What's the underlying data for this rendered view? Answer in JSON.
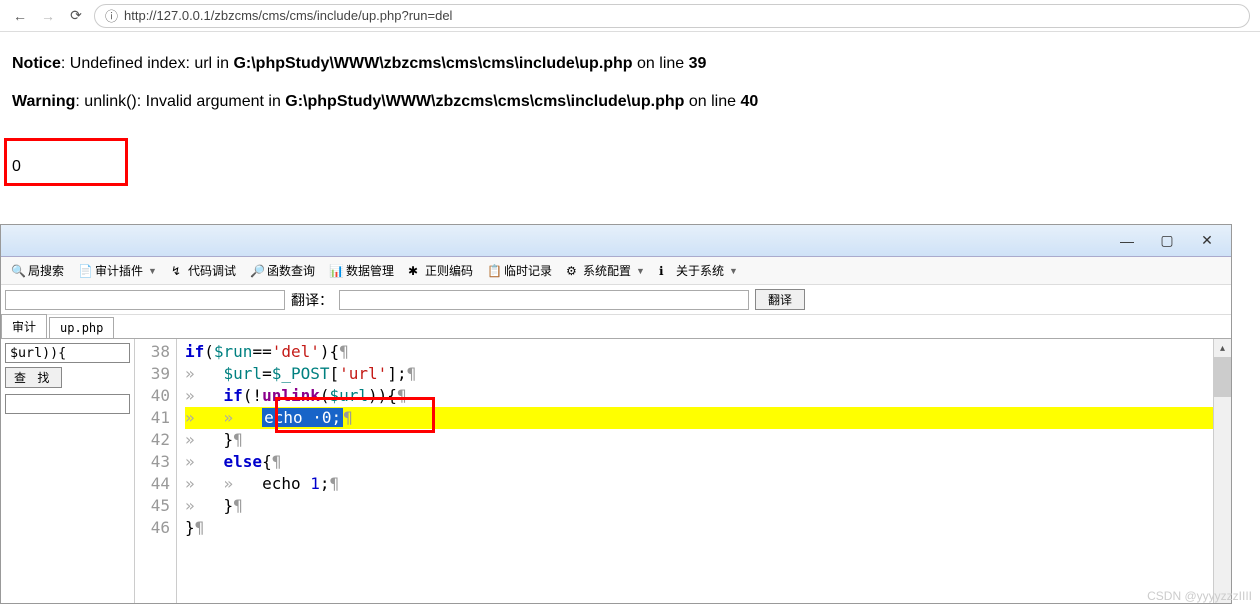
{
  "browser": {
    "url": "http://127.0.0.1/zbzcms/cms/cms/include/up.php?run=del"
  },
  "php": {
    "notice_label": "Notice",
    "notice_msg": ": Undefined index: url in ",
    "notice_path": "G:\\phpStudy\\WWW\\zbzcms\\cms\\cms\\include\\up.php",
    "notice_line_label": " on line ",
    "notice_line": "39",
    "warning_label": "Warning",
    "warning_msg": ": unlink(): Invalid argument in ",
    "warning_path": "G:\\phpStudy\\WWW\\zbzcms\\cms\\cms\\include\\up.php",
    "warning_line_label": " on line ",
    "warning_line": "40",
    "output": "0"
  },
  "toolbar": {
    "items": [
      "局搜索",
      "审计插件",
      "代码调试",
      "函数查询",
      "数据管理",
      "正则编码",
      "临时记录",
      "系统配置",
      "关于系统"
    ]
  },
  "searchbar": {
    "translate_label": "翻译：",
    "translate_btn": "翻译"
  },
  "tabs": [
    "审计",
    "up.php"
  ],
  "leftpanel": {
    "search_value": "$url)){",
    "find_btn": "查 找"
  },
  "code": {
    "lines": [
      {
        "num": "38",
        "indent": 0,
        "html": "<span class='kw'>if</span><span class='punct'>(</span><span class='var'>$run</span><span class='punct'>==</span><span class='str'>'del'</span><span class='punct'>){</span><span class='para'>¶</span>"
      },
      {
        "num": "39",
        "indent": 1,
        "html": "<span class='var'>$url</span><span class='punct'>=</span><span class='var'>$_POST</span><span class='punct'>[</span><span class='str'>'url'</span><span class='punct'>];</span><span class='para'>¶</span>"
      },
      {
        "num": "40",
        "indent": 1,
        "html": "<span class='kw'>if</span><span class='punct'>(!</span><span class='func'>unlink</span><span class='punct'>(</span><span class='var'>$url</span><span class='punct'>)){</span><span class='para'>¶</span>"
      },
      {
        "num": "41",
        "indent": 2,
        "hl": true,
        "html": "<span class='sel'>echo ·0;</span><span class='para'>¶</span>"
      },
      {
        "num": "42",
        "indent": 1,
        "html": "<span class='punct'>}</span><span class='para'>¶</span>"
      },
      {
        "num": "43",
        "indent": 1,
        "html": "<span class='kw'>else</span><span class='punct'>{</span><span class='para'>¶</span>"
      },
      {
        "num": "44",
        "indent": 2,
        "html": "echo <span class='num'>1</span><span class='punct'>;</span><span class='para'>¶</span>"
      },
      {
        "num": "45",
        "indent": 1,
        "html": "<span class='punct'>}</span><span class='para'>¶</span>"
      },
      {
        "num": "46",
        "indent": 0,
        "html": "<span class='punct'>}</span><span class='para'>¶</span>"
      }
    ]
  },
  "watermark": "CSDN @yyyyzzzIIII"
}
